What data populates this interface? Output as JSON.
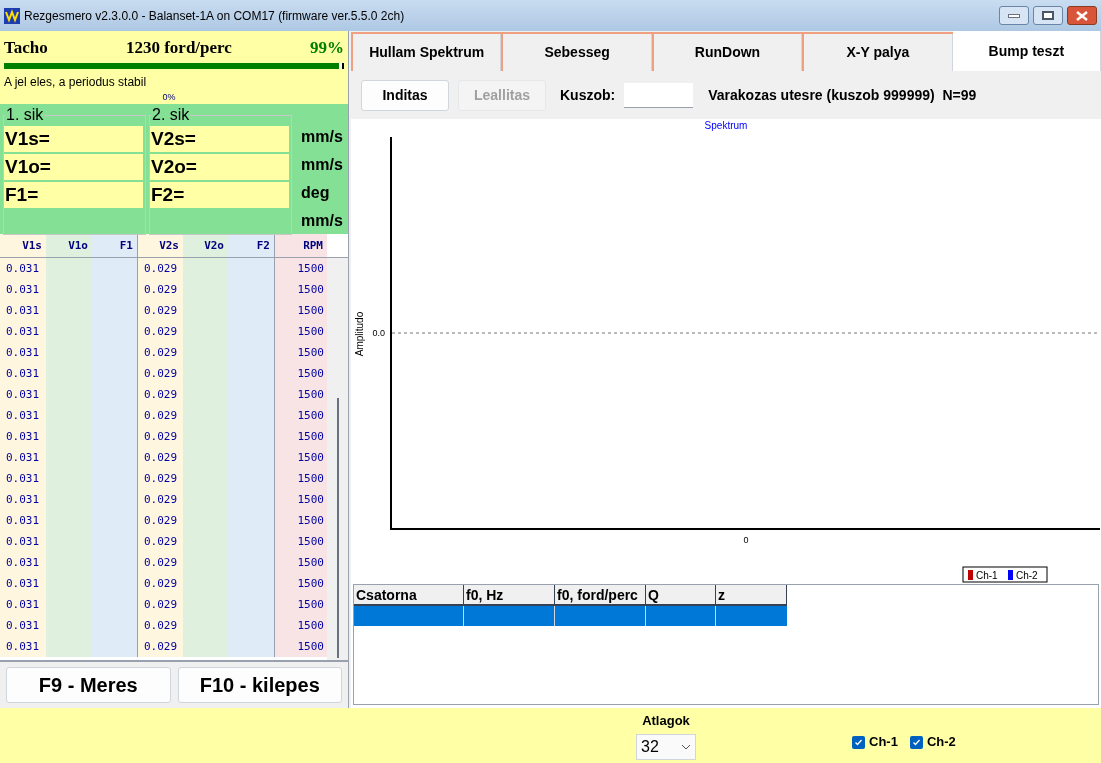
{
  "window": {
    "title": "Rezgesmero v2.3.0.0 - Balanset-1A on COM17 (firmware ver.5.5.0 2ch)"
  },
  "tacho": {
    "label": "Tacho",
    "speed": "1230 ford/perc",
    "percent": "99%",
    "level": 0.99,
    "status": "A jel eles, a periodus stabil",
    "progress_text": "0%"
  },
  "planes": [
    {
      "title": "1. sik",
      "fields": [
        "V1s=",
        "V1o=",
        "F1="
      ]
    },
    {
      "title": "2. sik",
      "fields": [
        "V2s=",
        "V2o=",
        "F2="
      ]
    }
  ],
  "units": [
    "mm/s",
    "mm/s",
    "deg",
    "mm/s"
  ],
  "log": {
    "columns": [
      "V1s",
      "V1o",
      "F1",
      "V2s",
      "V2o",
      "F2",
      "RPM"
    ],
    "rows": [
      {
        "v1s": "0.031",
        "v2s": "0.029",
        "rpm": "1500"
      },
      {
        "v1s": "0.031",
        "v2s": "0.029",
        "rpm": "1500"
      },
      {
        "v1s": "0.031",
        "v2s": "0.029",
        "rpm": "1500"
      },
      {
        "v1s": "0.031",
        "v2s": "0.029",
        "rpm": "1500"
      },
      {
        "v1s": "0.031",
        "v2s": "0.029",
        "rpm": "1500"
      },
      {
        "v1s": "0.031",
        "v2s": "0.029",
        "rpm": "1500"
      },
      {
        "v1s": "0.031",
        "v2s": "0.029",
        "rpm": "1500"
      },
      {
        "v1s": "0.031",
        "v2s": "0.029",
        "rpm": "1500"
      },
      {
        "v1s": "0.031",
        "v2s": "0.029",
        "rpm": "1500"
      },
      {
        "v1s": "0.031",
        "v2s": "0.029",
        "rpm": "1500"
      },
      {
        "v1s": "0.031",
        "v2s": "0.029",
        "rpm": "1500"
      },
      {
        "v1s": "0.031",
        "v2s": "0.029",
        "rpm": "1500"
      },
      {
        "v1s": "0.031",
        "v2s": "0.029",
        "rpm": "1500"
      },
      {
        "v1s": "0.031",
        "v2s": "0.029",
        "rpm": "1500"
      },
      {
        "v1s": "0.031",
        "v2s": "0.029",
        "rpm": "1500"
      },
      {
        "v1s": "0.031",
        "v2s": "0.029",
        "rpm": "1500"
      },
      {
        "v1s": "0.031",
        "v2s": "0.029",
        "rpm": "1500"
      },
      {
        "v1s": "0.031",
        "v2s": "0.029",
        "rpm": "1500"
      },
      {
        "v1s": "0.031",
        "v2s": "0.029",
        "rpm": "1500"
      }
    ]
  },
  "left_buttons": [
    "F9 - Meres",
    "F10 - kilepes"
  ],
  "tabs": [
    {
      "label": "Hullam Spektrum",
      "selected": false
    },
    {
      "label": "Sebesseg",
      "selected": false
    },
    {
      "label": "RunDown",
      "selected": false
    },
    {
      "label": "X-Y palya",
      "selected": false
    },
    {
      "label": "Bump teszt",
      "selected": true
    }
  ],
  "toolbar": {
    "buttons": [
      {
        "label": "Inditas",
        "disabled": false
      },
      {
        "label": "Leallitas",
        "disabled": true
      }
    ],
    "threshold_label": "Kuszob:",
    "status": "Varakozas utesre (kuszob 999999)  N=99"
  },
  "chart": {
    "title": "Spektrum",
    "ylabel": "Amplitudo",
    "x_tick": "0",
    "y_tick": "0.0",
    "legend": [
      {
        "name": "Ch-1",
        "color": "#c00000"
      },
      {
        "name": "Ch-2",
        "color": "#0000ff"
      }
    ]
  },
  "results": {
    "columns": [
      "Csatorna",
      "f0, Hz",
      "f0, ford/perc",
      "Q",
      "z"
    ],
    "rows": [
      {
        "selected": true
      }
    ]
  },
  "bottom": {
    "averages_label": "Atlagok",
    "averages_value": "32",
    "channels": [
      {
        "label": "Ch-1",
        "checked": true
      },
      {
        "label": "Ch-2",
        "checked": true
      }
    ]
  }
}
